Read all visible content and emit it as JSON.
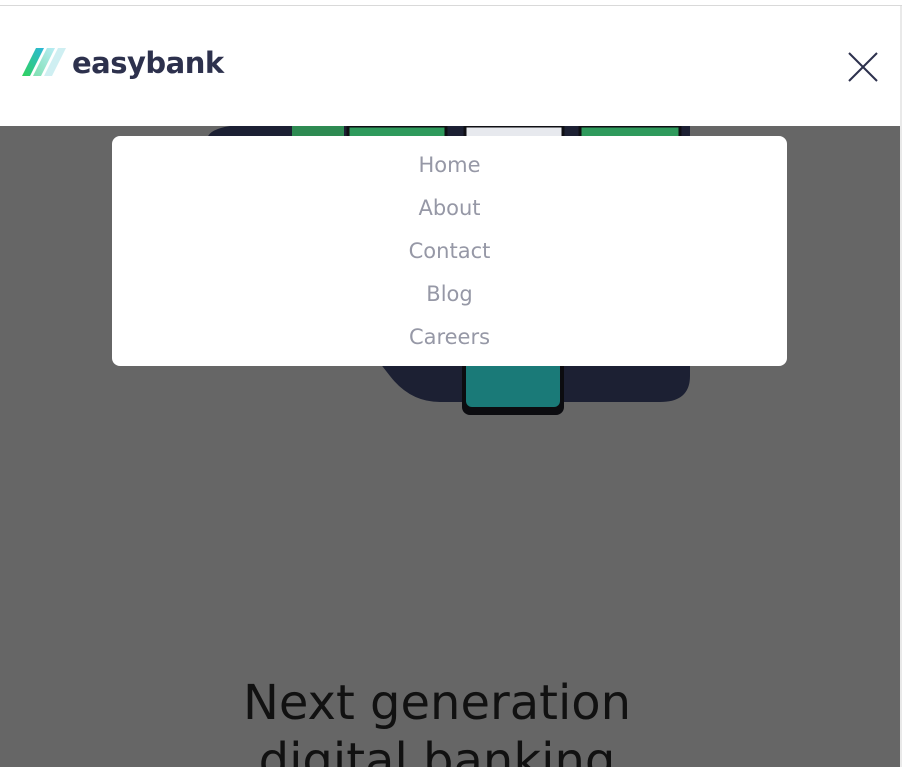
{
  "header": {
    "logo_text": "easybank",
    "close_label": "Close menu"
  },
  "menu": {
    "items": [
      {
        "label": "Home"
      },
      {
        "label": "About"
      },
      {
        "label": "Contact"
      },
      {
        "label": "Blog"
      },
      {
        "label": "Careers"
      }
    ]
  },
  "hero": {
    "title_line1": "Next generation",
    "title_line2": "digital banking"
  },
  "colors": {
    "brand_dark": "#2d314d",
    "brand_green": "#31d35c",
    "brand_cyan": "#2bb7da",
    "overlay": "#666666",
    "menu_text": "#9698a6"
  },
  "icons": {
    "logo": "easybank-logo-mark",
    "close": "close-icon"
  }
}
